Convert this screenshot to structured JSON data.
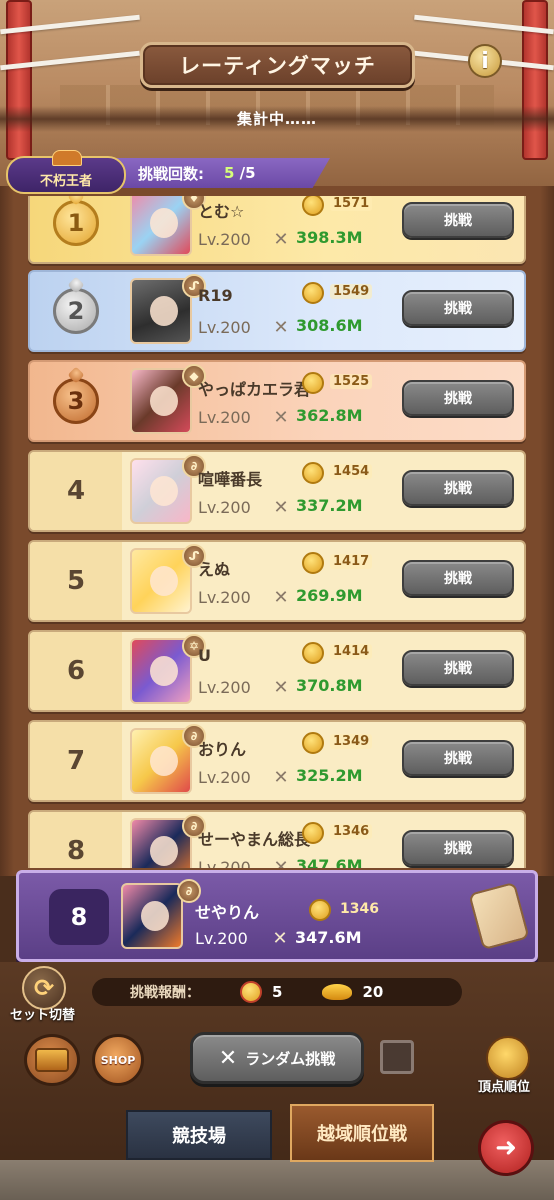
{
  "header": {
    "title": "レーティングマッチ",
    "info_icon": "i",
    "status": "集計中……"
  },
  "challenge": {
    "badge_title": "不朽王者",
    "label": "挑戦回数:",
    "current": "5",
    "max": "/5"
  },
  "rows": [
    {
      "rank": "1",
      "name": "とむ☆",
      "level": "Lv.200",
      "rating": "1571",
      "power": "398.3M",
      "button": "挑戦",
      "tier_icon": "♦"
    },
    {
      "rank": "2",
      "name": "R19",
      "level": "Lv.200",
      "rating": "1549",
      "power": "308.6M",
      "button": "挑戦",
      "tier_icon": "ᔑ"
    },
    {
      "rank": "3",
      "name": "やっぱカエラ君",
      "level": "Lv.200",
      "rating": "1525",
      "power": "362.8M",
      "button": "挑戦",
      "tier_icon": "◆"
    },
    {
      "rank": "4",
      "name": "喧嘩番長",
      "level": "Lv.200",
      "rating": "1454",
      "power": "337.2M",
      "button": "挑戦",
      "tier_icon": "∂"
    },
    {
      "rank": "5",
      "name": "えぬ",
      "level": "Lv.200",
      "rating": "1417",
      "power": "269.9M",
      "button": "挑戦",
      "tier_icon": "ᔑ"
    },
    {
      "rank": "6",
      "name": "U",
      "level": "Lv.200",
      "rating": "1414",
      "power": "370.8M",
      "button": "挑戦",
      "tier_icon": "✡"
    },
    {
      "rank": "7",
      "name": "おりん",
      "level": "Lv.200",
      "rating": "1349",
      "power": "325.2M",
      "button": "挑戦",
      "tier_icon": "∂"
    },
    {
      "rank": "8",
      "name": "せーやまん総長",
      "level": "Lv.200",
      "rating": "1346",
      "power": "347.6M",
      "button": "挑戦",
      "tier_icon": "∂"
    }
  ],
  "me": {
    "rank": "8",
    "name": "せやりん",
    "level": "Lv.200",
    "rating": "1346",
    "power": "347.6M",
    "tier_icon": "∂"
  },
  "bottom": {
    "set_switch_label": "セット切替",
    "reward_label": "挑戦報酬：",
    "reward_medal": "5",
    "reward_lamp": "20",
    "shop_label": "SHOP",
    "random_button": "ランダム挑戦",
    "peak_rank_label": "頂点順位",
    "tab_arena": "競技場",
    "tab_cross": "越域順位戦"
  },
  "colors": {
    "power_green": "#2f9a2f",
    "my_row_purple": "#6b49a6",
    "gold_row": "#fde9a8",
    "silver_row": "#dde9fb",
    "bronze_row": "#fbd4bb"
  }
}
